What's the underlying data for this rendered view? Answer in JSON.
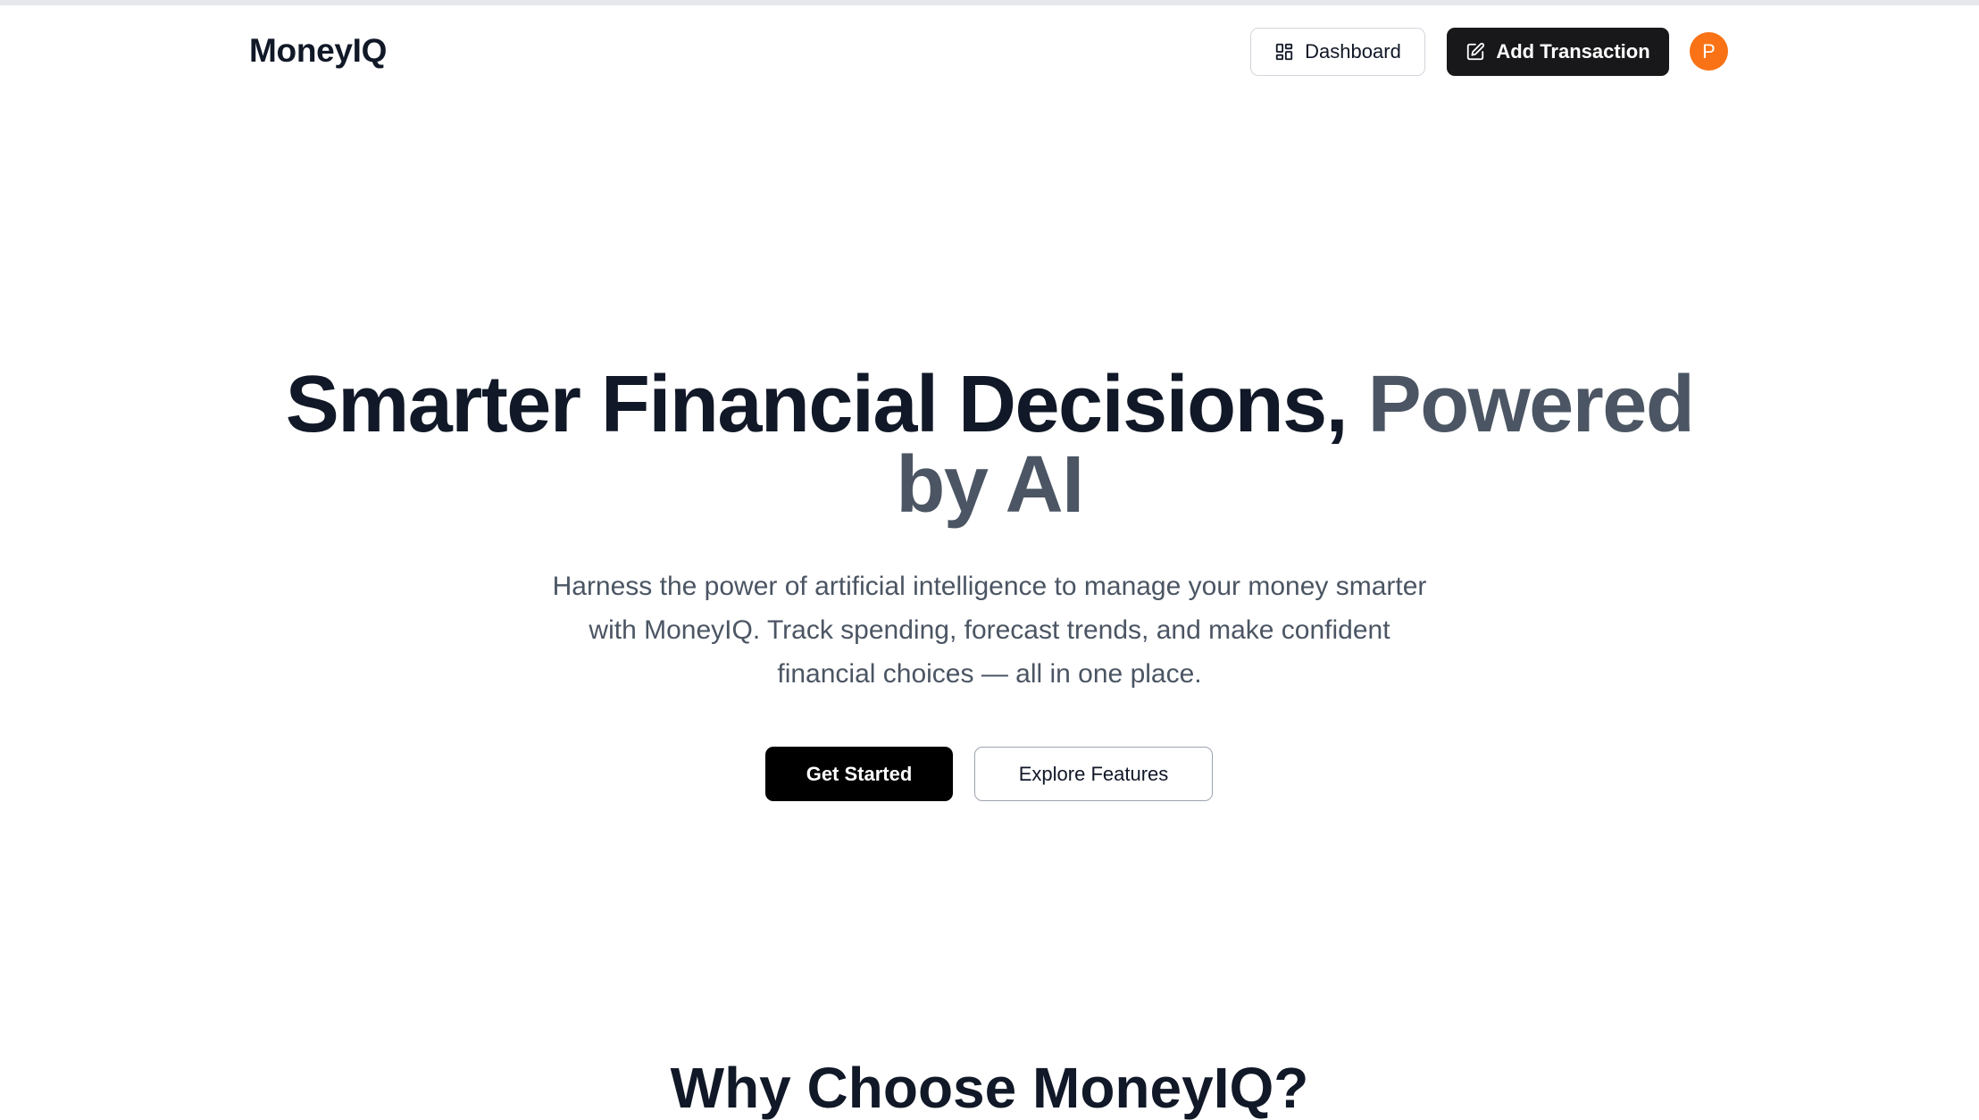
{
  "header": {
    "brand": "MoneyIQ",
    "dashboard_label": "Dashboard",
    "add_transaction_label": "Add Transaction",
    "avatar_initial": "P",
    "dashboard_icon": "layout-grid-icon",
    "add_transaction_icon": "edit-icon"
  },
  "hero": {
    "title_main": "Smarter Financial Decisions, ",
    "title_accent_1": "Powered",
    "title_accent_2": "by AI",
    "subtitle": "Harness the power of artificial intelligence to manage your money smarter with MoneyIQ. Track spending, forecast trends, and make confident financial choices — all in one place.",
    "primary_cta": "Get Started",
    "secondary_cta": "Explore Features"
  },
  "features": {
    "heading": "Why Choose MoneyIQ?"
  },
  "colors": {
    "accent_orange": "#f97316",
    "dark": "#18181b",
    "title": "#111827",
    "muted": "#4b5563"
  }
}
